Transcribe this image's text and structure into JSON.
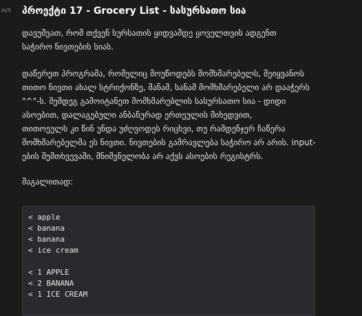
{
  "gutter": {
    "label": "ᲠᲝ"
  },
  "problem": {
    "title": "პროექტი 17 - Grocery List - სასურსათო სია",
    "paragraph1_line1": "დავუშვათ, რომ თქვენ სურსათის ყიდვამდე ყოველთვის ადგენთ",
    "paragraph1_line2": "საჭირო ნივთების სიას.",
    "paragraph2_lines": [
      "დაწერეთ პროგრამა, რომელიც მოუწოდებს მომხმარებელს, შეიყვანოს",
      "თითო ნივთი ახალ სტრიქონზე, მანამ, სანამ მომხმარებელი არ დააჭერს",
      "\"^\"-ს. შემდეგ გამოიტანეთ მომხმარებლის სასურსათო სია - დიდი",
      "ასოებით, დალაგებული ანბანურად ერთეულის მიხედვით,",
      "თითოეულს კი წინ უნდა უძღვოდეს რიცხვი, თუ რამდენჯერ ჩაწერა",
      "მომხმარებელმა ეს ნივთი. ნივთების გამრავლება საჭირო არ არის. input-",
      "ების  შემთხვევაში, მნიშვნელობა არ აქვს ასოების რეგისტრს."
    ],
    "example_label": "მაგალითად:"
  },
  "example": {
    "input_lines": [
      "< apple",
      "< banana",
      "< banana",
      "< ice cream"
    ],
    "output_lines": [
      "< 1 APPLE",
      "< 2 BANANA",
      "< 1 ICE CREAM"
    ]
  }
}
